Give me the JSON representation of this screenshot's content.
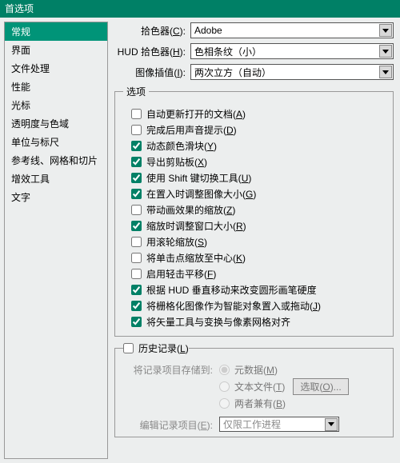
{
  "window": {
    "title": "首选项"
  },
  "sidebar": {
    "items": [
      "常规",
      "界面",
      "文件处理",
      "性能",
      "光标",
      "透明度与色域",
      "单位与标尺",
      "参考线、网格和切片",
      "增效工具",
      "文字"
    ],
    "selectedIndex": 0
  },
  "pickers": {
    "colorPicker": {
      "label": "拾色器",
      "hotkey": "C",
      "value": "Adobe"
    },
    "hudPicker": {
      "label": "HUD 拾色器",
      "hotkey": "H",
      "value": "色相条纹（小）"
    },
    "interp": {
      "label": "图像插值",
      "hotkey": "I",
      "value": "两次立方（自动）"
    }
  },
  "optionsGroup": {
    "legend": "选项",
    "items": [
      {
        "label": "自动更新打开的文档",
        "hotkey": "A",
        "checked": false
      },
      {
        "label": "完成后用声音提示",
        "hotkey": "D",
        "checked": false
      },
      {
        "label": "动态颜色滑块",
        "hotkey": "Y",
        "checked": true
      },
      {
        "label": "导出剪贴板",
        "hotkey": "X",
        "checked": true
      },
      {
        "label": "使用 Shift 键切换工具",
        "hotkey": "U",
        "checked": true
      },
      {
        "label": "在置入时调整图像大小",
        "hotkey": "G",
        "checked": true
      },
      {
        "label": "带动画效果的缩放",
        "hotkey": "Z",
        "checked": false
      },
      {
        "label": "缩放时调整窗口大小",
        "hotkey": "R",
        "checked": true
      },
      {
        "label": "用滚轮缩放",
        "hotkey": "S",
        "checked": false
      },
      {
        "label": "将单击点缩放至中心",
        "hotkey": "K",
        "checked": false
      },
      {
        "label": "启用轻击平移",
        "hotkey": "F",
        "checked": false
      },
      {
        "label": "根据 HUD 垂直移动来改变圆形画笔硬度",
        "hotkey": "",
        "checked": true
      },
      {
        "label": "将栅格化图像作为智能对象置入或拖动",
        "hotkey": "J",
        "checked": true
      },
      {
        "label": "将矢量工具与变换与像素网格对齐",
        "hotkey": "",
        "checked": true
      }
    ]
  },
  "history": {
    "enable": {
      "label": "历史记录",
      "hotkey": "L",
      "checked": false
    },
    "saveTo": {
      "label": "将记录项目存储到:"
    },
    "radios": [
      {
        "label": "元数据",
        "hotkey": "M",
        "selected": true
      },
      {
        "label": "文本文件",
        "hotkey": "T",
        "selected": false,
        "button": {
          "label": "选取",
          "hotkey": "O"
        }
      },
      {
        "label": "两者兼有",
        "hotkey": "B",
        "selected": false
      }
    ],
    "editItems": {
      "label": "编辑记录项目",
      "hotkey": "E",
      "value": "仅限工作进程"
    }
  }
}
